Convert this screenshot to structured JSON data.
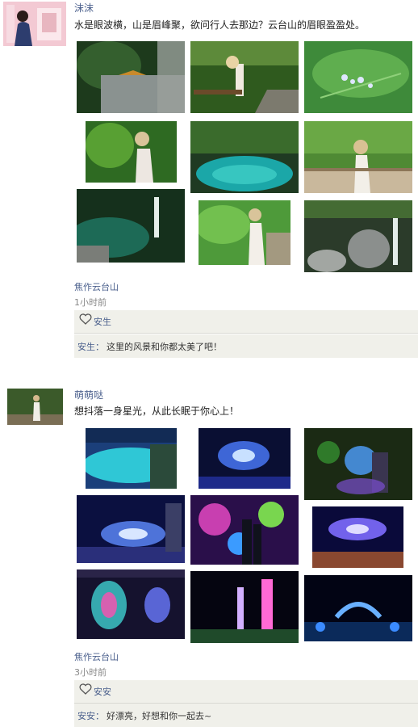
{
  "posts": [
    {
      "username": "沫沫",
      "text": "水是眼波横，山是眉峰聚，欲问行人去那边？云台山的眉眼盈盈处。",
      "location": "焦作云台山",
      "time": "1小时前",
      "likes": "安生",
      "comment": {
        "user": "安生：",
        "text": "这里的风景和你都太美了吧！"
      }
    },
    {
      "username": "萌萌哒",
      "text": "想抖落一身星光，从此长眠于你心上！",
      "location": "焦作云台山",
      "time": "3小时前",
      "likes": "安安",
      "comment": {
        "user": "安安：",
        "text": "好漂亮，好想和你一起去~"
      }
    }
  ],
  "colors": {
    "link": "#4a5f8c",
    "panel": "#f0f0ea"
  }
}
